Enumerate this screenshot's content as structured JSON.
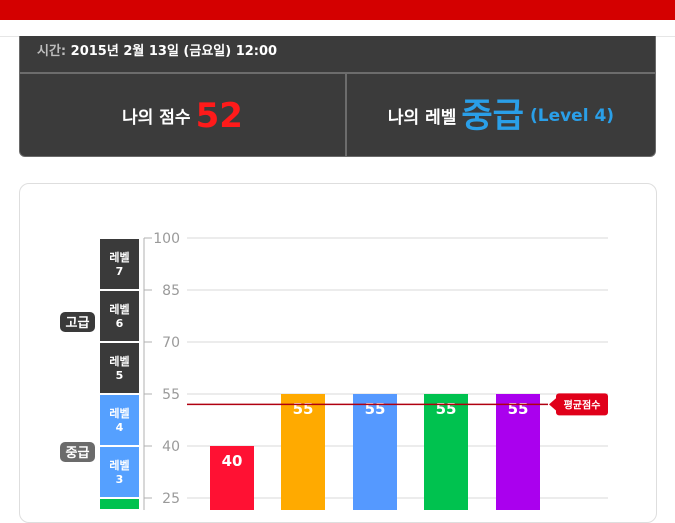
{
  "header": {
    "time_key": "시간:",
    "time_value": "2015년 2월 13일 (금요일) 12:00",
    "my_score_label": "나의 점수",
    "my_score_value": "52",
    "my_level_label": "나의 레벨",
    "my_level_value": "중급",
    "my_level_detail": "(Level 4)"
  },
  "colors": {
    "top_bar": "#d40000",
    "score_red": "#ff1a1a",
    "level_blue": "#2a9fe8",
    "card_dark": "#3b3b3b"
  },
  "chart_data": {
    "type": "bar",
    "ylim": [
      25,
      100
    ],
    "yticks": [
      25,
      40,
      55,
      70,
      85,
      100
    ],
    "values": [
      40,
      55,
      55,
      55,
      55
    ],
    "bar_labels": [
      "40",
      "55",
      "55",
      "55",
      "55"
    ],
    "colors": [
      "#ff1133",
      "#ffaa00",
      "#5599ff",
      "#00c24f",
      "#aa00ee"
    ],
    "average": 52,
    "average_label": "평균점수",
    "grid": true,
    "level_scale": [
      {
        "label": "레벨",
        "num": "7",
        "from": 85,
        "to": 100,
        "color": "#3a3a3a"
      },
      {
        "label": "레벨",
        "num": "6",
        "from": 70,
        "to": 85,
        "color": "#3a3a3a"
      },
      {
        "label": "레벨",
        "num": "5",
        "from": 55,
        "to": 70,
        "color": "#3a3a3a"
      },
      {
        "label": "레벨",
        "num": "4",
        "from": 40,
        "to": 55,
        "color": "#55a0ff"
      },
      {
        "label": "레벨",
        "num": "3",
        "from": 25,
        "to": 40,
        "color": "#55a0ff"
      },
      {
        "label": "",
        "num": "",
        "from": 10,
        "to": 25,
        "color": "#00c24f"
      }
    ],
    "tiers": [
      {
        "label": "고급",
        "at": 77.5,
        "color": "#3a3a3a"
      },
      {
        "label": "중급",
        "at": 40,
        "color": "#6b6b6b"
      }
    ]
  }
}
